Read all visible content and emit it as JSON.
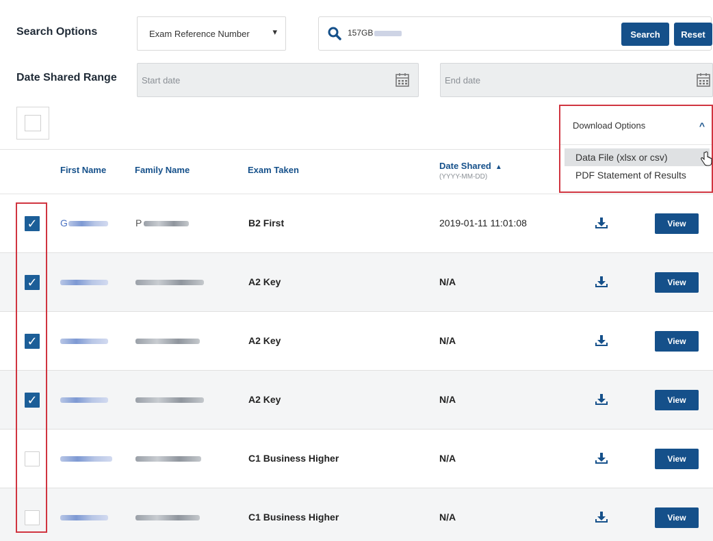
{
  "search": {
    "label": "Search Options",
    "type_selected": "Exam Reference Number",
    "query_prefix": "157GB",
    "search_button": "Search",
    "reset_button": "Reset"
  },
  "date_range": {
    "label": "Date Shared Range",
    "start_placeholder": "Start date",
    "end_placeholder": "End date"
  },
  "download_menu": {
    "title": "Download Options",
    "items": [
      {
        "label": "Data File (xlsx or csv)"
      },
      {
        "label": "PDF Statement of Results"
      }
    ]
  },
  "table": {
    "headers": {
      "first_name": "First Name",
      "family_name": "Family Name",
      "exam_taken": "Exam Taken",
      "date_shared": "Date Shared",
      "date_format": "(YYYY-MM-DD)"
    },
    "view_label": "View",
    "rows": [
      {
        "checked": true,
        "first_initial": "G",
        "family_initial": "P",
        "exam": "B2 First",
        "date": "2019-01-11 11:01:08"
      },
      {
        "checked": true,
        "exam": "A2 Key",
        "date": "N/A"
      },
      {
        "checked": true,
        "exam": "A2 Key",
        "date": "N/A"
      },
      {
        "checked": true,
        "exam": "A2 Key",
        "date": "N/A"
      },
      {
        "checked": false,
        "exam": "C1 Business Higher",
        "date": "N/A"
      },
      {
        "checked": false,
        "exam": "C1 Business Higher",
        "date": "N/A"
      }
    ]
  },
  "colors": {
    "primary": "#15508a",
    "highlight_border": "#d0343f",
    "checkbox_on": "#1c5e98"
  }
}
